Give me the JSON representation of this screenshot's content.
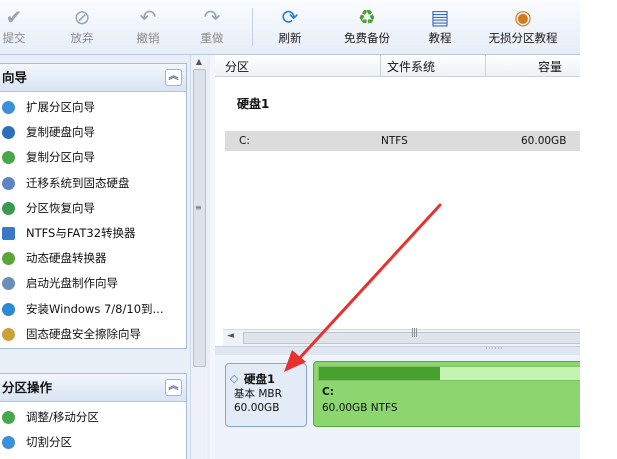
{
  "toolbar": {
    "commit": "提交",
    "discard": "放弃",
    "undo": "撤销",
    "redo": "重做",
    "refresh": "刷新",
    "free_backup": "免费备份",
    "tutorial": "教程",
    "lossless_tutorial": "无损分区教程"
  },
  "wizard_panel": {
    "title": "向导",
    "items": [
      "扩展分区向导",
      "复制硬盘向导",
      "复制分区向导",
      "迁移系统到固态硬盘",
      "分区恢复向导",
      "NTFS与FAT32转换器",
      "动态硬盘转换器",
      "启动光盘制作向导",
      "安装Windows 7/8/10到...",
      "固态硬盘安全擦除向导"
    ]
  },
  "partition_ops": {
    "title": "分区操作",
    "items": [
      "调整/移动分区",
      "切割分区"
    ]
  },
  "columns": {
    "partition": "分区",
    "filesystem": "文件系统",
    "capacity": "容量"
  },
  "disk_list": {
    "disk_label": "硬盘1",
    "row": {
      "partition": "C:",
      "filesystem": "NTFS",
      "capacity": "60.00GB"
    }
  },
  "disk_map": {
    "disk_title": "硬盘1",
    "disk_type": "基本 MBR",
    "disk_size": "60.00GB",
    "partition_letter": "C:",
    "partition_info": "60.00GB NTFS",
    "used_fraction": 0.44
  },
  "colors": {
    "partition_green": "#8bd66e",
    "used_fill": "#46a12e",
    "arrow_red": "#e8312f"
  }
}
